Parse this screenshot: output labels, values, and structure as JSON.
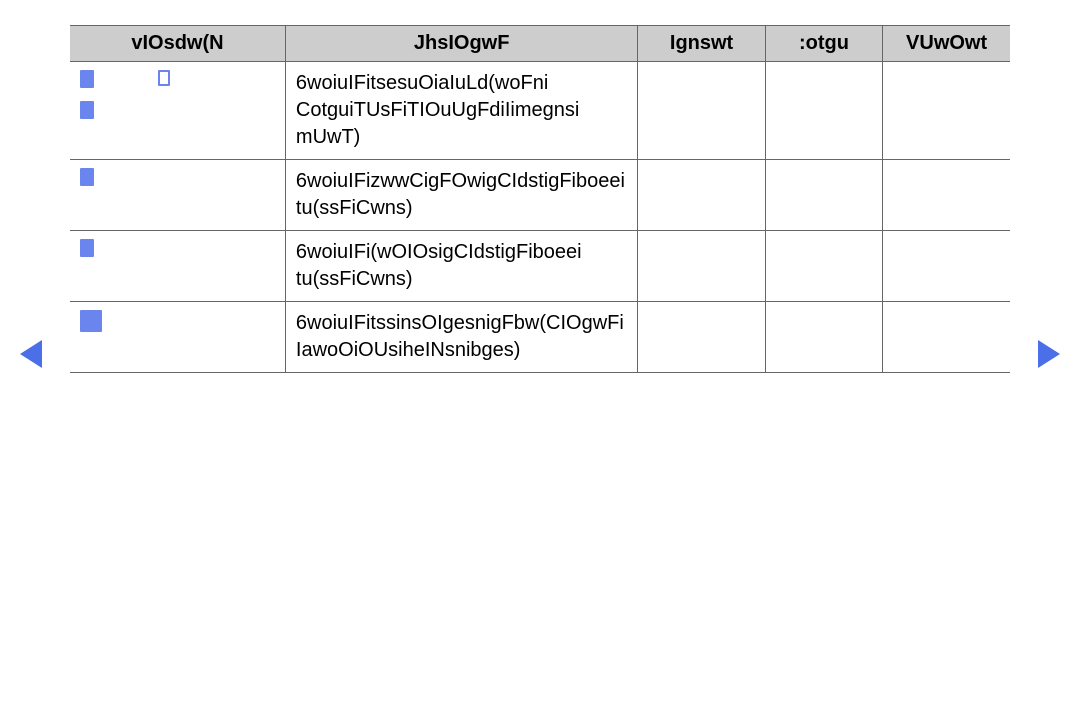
{
  "columns": {
    "c1": "vIOsdw(N",
    "c2": "JhsIOgwF",
    "c3": "Ignswt",
    "c4": ":otgu",
    "c5": "VUwOwt"
  },
  "rows": [
    {
      "icons": [
        "fill",
        "outline",
        "fill"
      ],
      "desc": "6woiuIFitsesuOiaIuLd(woFni CotguiTUsFiTIOuUgFdiIimegnsi mUwT)",
      "c3": "",
      "c4": "",
      "c5": ""
    },
    {
      "icons": [
        "fill"
      ],
      "desc": "6woiuIFizwwCigFOwigCIdstigFiboeei tu(ssFiCwns)",
      "c3": "",
      "c4": "",
      "c5": ""
    },
    {
      "icons": [
        "fill"
      ],
      "desc": "6woiuIFi(wOIOsigCIdstigFiboeei tu(ssFiCwns)",
      "c3": "",
      "c4": "",
      "c5": ""
    },
    {
      "icons": [
        "big"
      ],
      "desc": "6woiuIFitssinsOIgesnigFbw(CIOgwFi IawoOiOUsiheINsnibges)",
      "c3": "",
      "c4": "",
      "c5": ""
    }
  ],
  "page_number": " "
}
